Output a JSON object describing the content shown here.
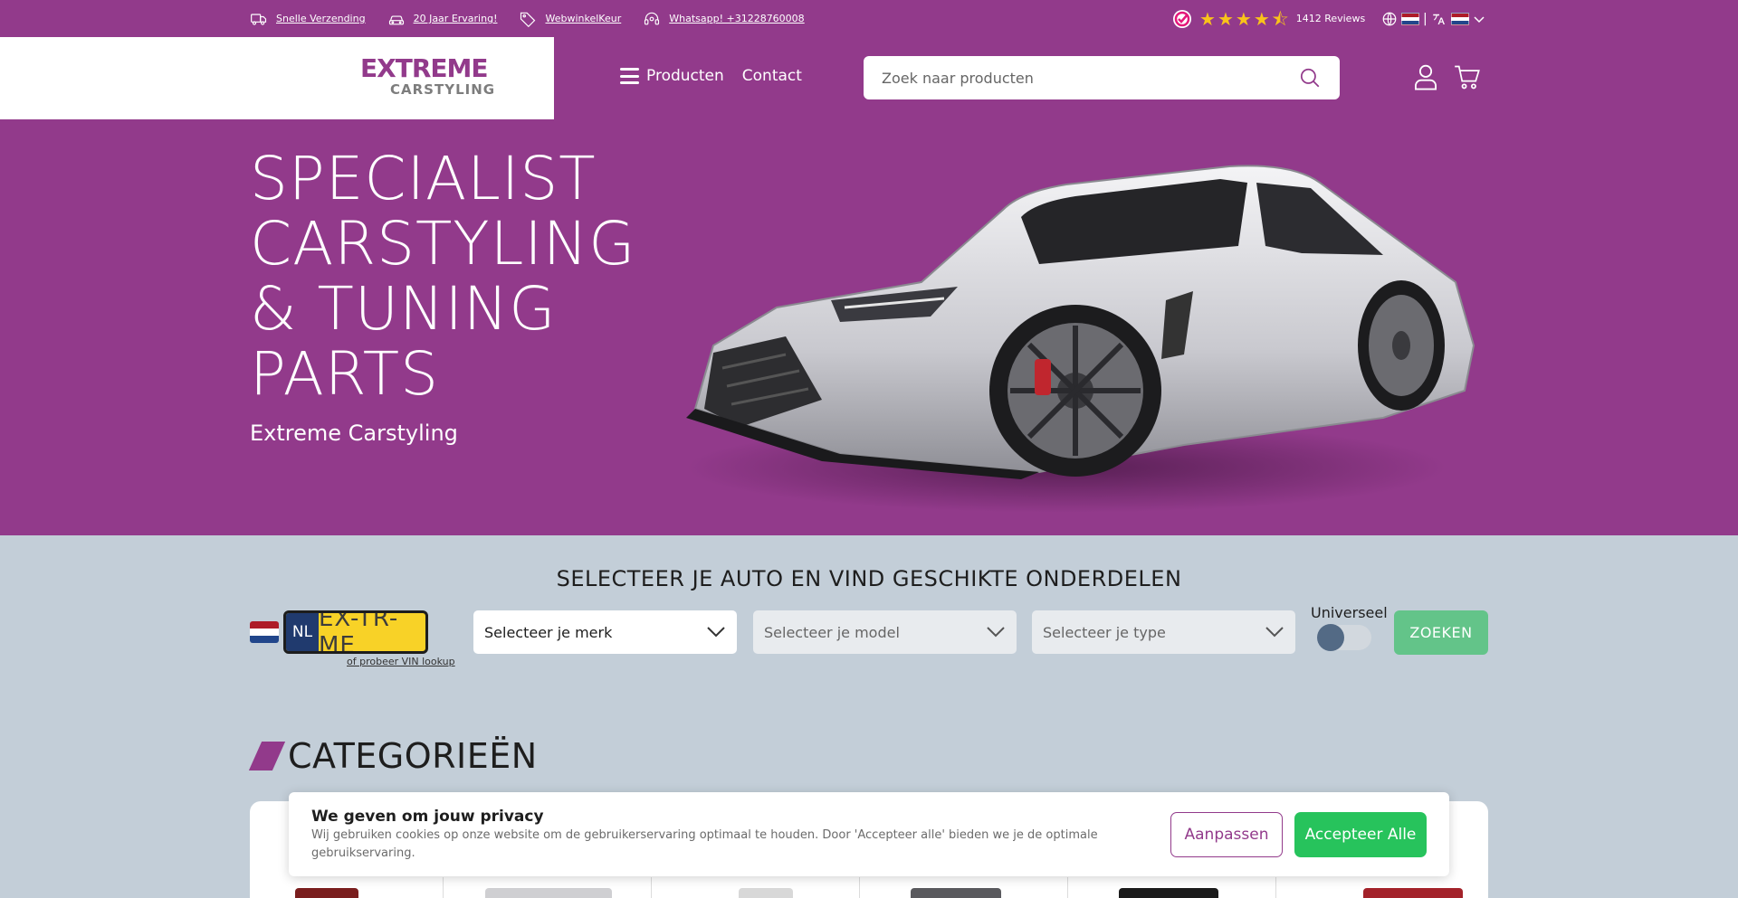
{
  "topbar": {
    "usps": [
      {
        "icon": "truck-icon",
        "label": "Snelle Verzending"
      },
      {
        "icon": "car-icon",
        "label": "20 Jaar Ervaring!"
      },
      {
        "icon": "tag-icon",
        "label": "WebwinkelKeur"
      },
      {
        "icon": "headset-icon",
        "label": "Whatsapp! +31228760008"
      }
    ],
    "rating_stars": 4.5,
    "reviews_label": "1412 Reviews"
  },
  "header": {
    "logo_line1": "EXTREME",
    "logo_line2": "CARSTYLING",
    "nav": [
      {
        "label": "Producten"
      },
      {
        "label": "Contact"
      }
    ],
    "search_placeholder": "Zoek naar producten"
  },
  "hero": {
    "title_lines": [
      "SPECIALIST",
      "CARSTYLING",
      "& TUNING",
      "PARTS"
    ],
    "subtitle": "Extreme Carstyling"
  },
  "selector": {
    "title": "SELECTEER JE AUTO EN VIND GESCHIKTE ONDERDELEN",
    "plate_country": "NL",
    "plate_number": "EX-TR-ME",
    "vin_link": "of probeer VIN lookup",
    "brand_placeholder": "Selecteer je merk",
    "model_placeholder": "Selecteer je model",
    "type_placeholder": "Selecteer je type",
    "universal_label": "Universeel",
    "search_button": "ZOEKEN"
  },
  "categories": {
    "title": "CATEGORIEËN"
  },
  "cookie": {
    "title": "We geven om jouw privacy",
    "text": "Wij gebruiken cookies op onze website om de gebruikerservaring optimaal te houden. Door 'Accepteer alle' bieden we je de optimale gebruikservaring.",
    "adjust_button": "Aanpassen",
    "accept_button": "Accepteer Alle"
  },
  "colors": {
    "brand_purple": "#923a8b",
    "accept_green": "#27c35c",
    "search_green": "#63c489",
    "page_bg": "#c3ced8",
    "plate_yellow": "#f8d227"
  }
}
